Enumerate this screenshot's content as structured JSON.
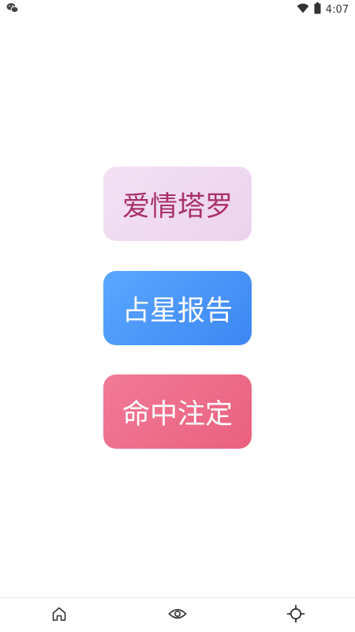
{
  "status_bar": {
    "left_icon": "wechat-icon",
    "wifi_icon": "wifi-icon",
    "battery_icon": "battery-icon",
    "time": "4:07"
  },
  "menu": {
    "items": [
      {
        "label": "爱情塔罗",
        "color": "#a8316a"
      },
      {
        "label": "占星报告",
        "color": "#ffffff"
      },
      {
        "label": "命中注定",
        "color": "#ffffff"
      }
    ]
  },
  "bottom_nav": {
    "items": [
      {
        "icon": "home-icon"
      },
      {
        "icon": "eye-icon"
      },
      {
        "icon": "sun-icon"
      }
    ]
  }
}
